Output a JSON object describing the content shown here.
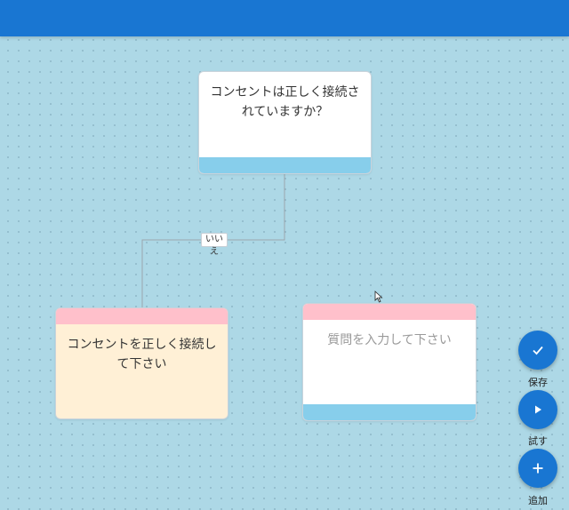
{
  "canvas": {
    "background": "#add8e6",
    "topbar_color": "#1976d2"
  },
  "nodes": {
    "question_1": {
      "text": "コンセントは正しく接続されていますか？"
    },
    "answer_1": {
      "text": "コンセントを正しく接続して下さい"
    },
    "question_2": {
      "placeholder": "質問を入力して下さい"
    }
  },
  "edges": [
    {
      "label": "いいえ"
    }
  ],
  "actions": {
    "save": {
      "label": "保存",
      "icon": "check-icon"
    },
    "try": {
      "label": "試す",
      "icon": "play-icon"
    },
    "add": {
      "label": "追加",
      "icon": "plus-icon"
    }
  },
  "colors": {
    "accent": "#1976d2",
    "question_band": "#87ceeb",
    "answer_band": "#ffc0cb",
    "answer_body": "#fff0d6"
  }
}
